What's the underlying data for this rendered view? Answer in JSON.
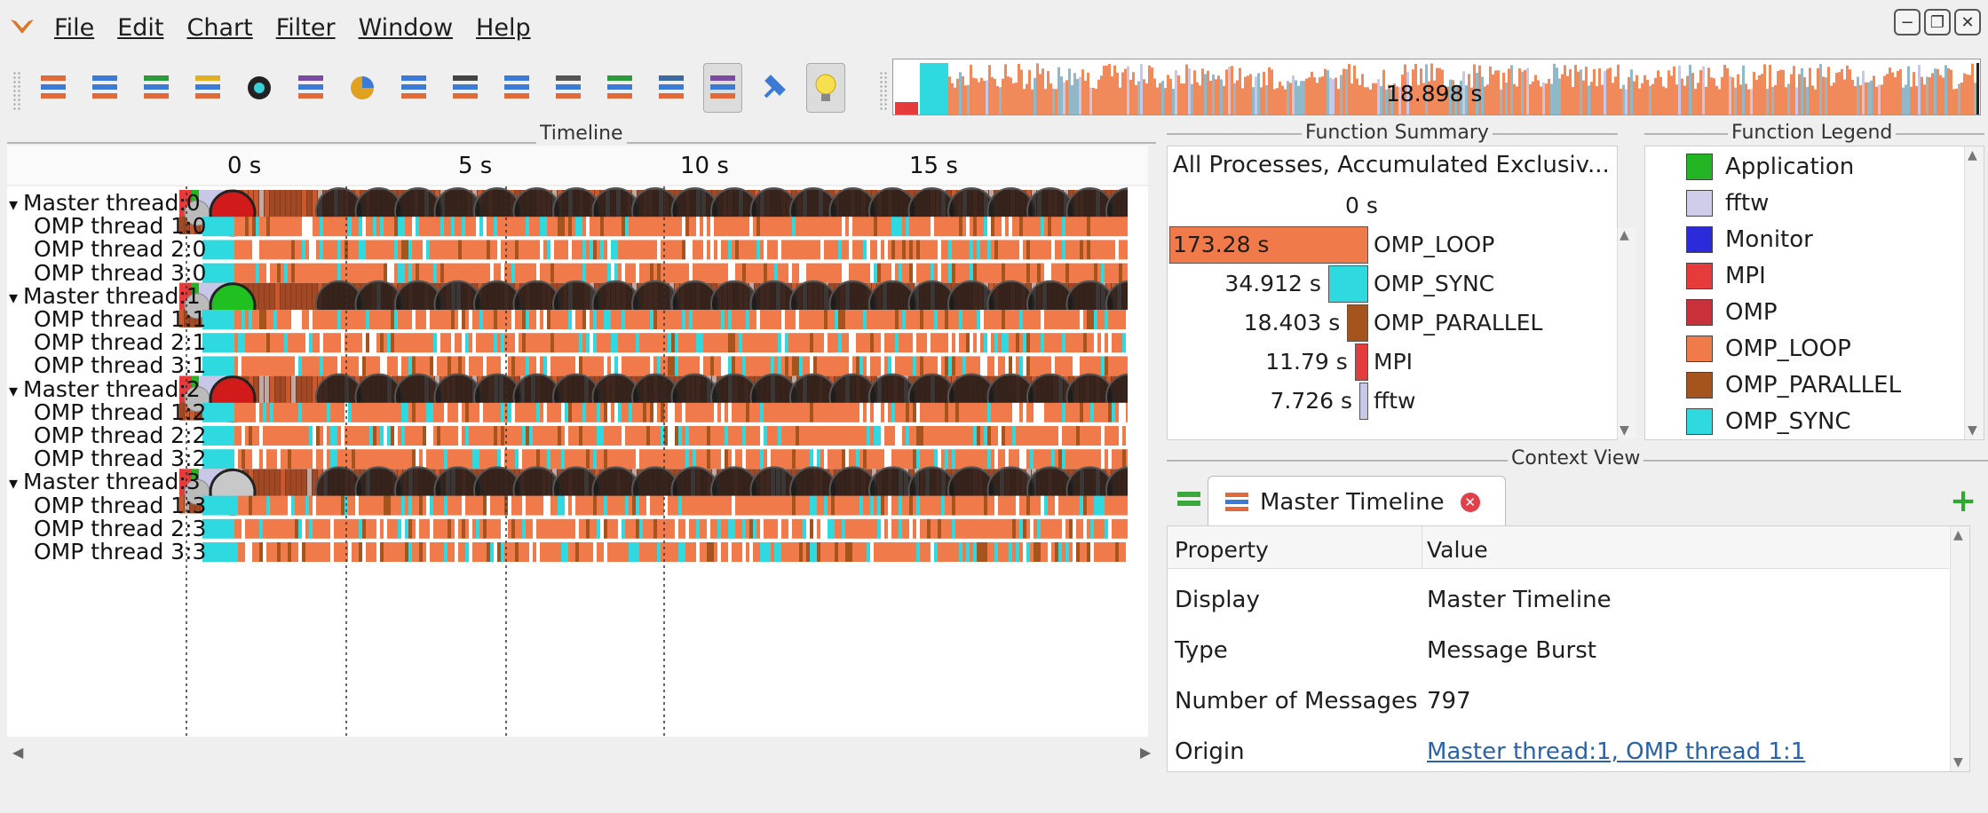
{
  "menu": {
    "items": [
      "File",
      "Edit",
      "Chart",
      "Filter",
      "Window",
      "Help"
    ]
  },
  "overview": {
    "label": "18.898 s"
  },
  "timeline": {
    "title": "Timeline",
    "ticks": [
      "0 s",
      "5 s",
      "10 s",
      "15 s"
    ],
    "rows": [
      "Master thread:0",
      "OMP thread 1:0",
      "OMP thread 2:0",
      "OMP thread 3:0",
      "Master thread:1",
      "OMP thread 1:1",
      "OMP thread 2:1",
      "OMP thread 3:1",
      "Master thread:2",
      "OMP thread 1:2",
      "OMP thread 2:2",
      "OMP thread 3:2",
      "Master thread:3",
      "OMP thread 1:3",
      "OMP thread 2:3",
      "OMP thread 3:3"
    ]
  },
  "function_summary": {
    "title": "Function Summary",
    "header": "All Processes, Accumulated Exclusiv...",
    "axis_zero": "0 s",
    "items": [
      {
        "value_label": "173.28 s",
        "name": "OMP_LOOP",
        "value": 173.28,
        "color": "#f07a4a"
      },
      {
        "value_label": "34.912 s",
        "name": "OMP_SYNC",
        "value": 34.912,
        "color": "#2fd9e0"
      },
      {
        "value_label": "18.403 s",
        "name": "OMP_PARALLEL",
        "value": 18.403,
        "color": "#a6541e"
      },
      {
        "value_label": "11.79 s",
        "name": "MPI",
        "value": 11.79,
        "color": "#e53b3b"
      },
      {
        "value_label": "7.726 s",
        "name": "fftw",
        "value": 7.726,
        "color": "#c9c7e8"
      }
    ]
  },
  "legend": {
    "title": "Function Legend",
    "items": [
      {
        "name": "Application",
        "color": "#22b422"
      },
      {
        "name": "fftw",
        "color": "#cfcdea"
      },
      {
        "name": "Monitor",
        "color": "#2b2bd9"
      },
      {
        "name": "MPI",
        "color": "#e53b3b"
      },
      {
        "name": "OMP",
        "color": "#c8313a"
      },
      {
        "name": "OMP_LOOP",
        "color": "#f07a4a"
      },
      {
        "name": "OMP_PARALLEL",
        "color": "#a6541e"
      },
      {
        "name": "OMP_SYNC",
        "color": "#2fd9e0"
      }
    ]
  },
  "context_view": {
    "title": "Context View",
    "tab_label": "Master Timeline",
    "header": {
      "property": "Property",
      "value": "Value"
    },
    "rows": [
      {
        "property": "Display",
        "value": "Master Timeline",
        "link": false
      },
      {
        "property": "Type",
        "value": "Message Burst",
        "link": false
      },
      {
        "property": "Number of Messages",
        "value": "797",
        "link": false
      },
      {
        "property": "Origin",
        "value": "Master thread:1, OMP thread 1:1",
        "link": true
      }
    ]
  },
  "markers": {
    "master0": "#d11b1b",
    "master1": "#20c020",
    "master2": "#d11b1b",
    "master3": "#c8c8c8"
  }
}
